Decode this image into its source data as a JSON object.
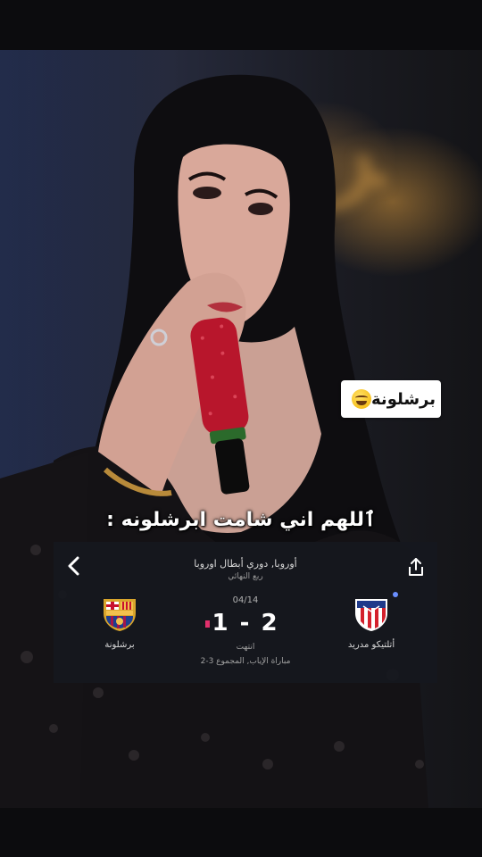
{
  "sticker": {
    "text": "برشلونة",
    "emoji_icon": "laughing-tears-emoji"
  },
  "caption": "ٱللهم اني شامت ابرشلونه :",
  "match": {
    "competition": "أوروبا, دوري أبطال اوروبا",
    "round": "ربع النهائي",
    "date": "04/14",
    "score": "1 - 2",
    "status": "انتهت",
    "leg_info": "مباراة الإياب, المجموع 3-2",
    "home_team": "برشلونة",
    "away_team": "أتلتيكو مدريد",
    "colors": {
      "card_bg": "#16181e",
      "marker": "#e1306c",
      "barca_blue": "#1d3f8f",
      "barca_red": "#a3154a",
      "atletico_red": "#d4202c",
      "atletico_blue": "#1f3a8a"
    },
    "icons": {
      "back": "chevron-left-icon",
      "share": "share-icon"
    }
  }
}
